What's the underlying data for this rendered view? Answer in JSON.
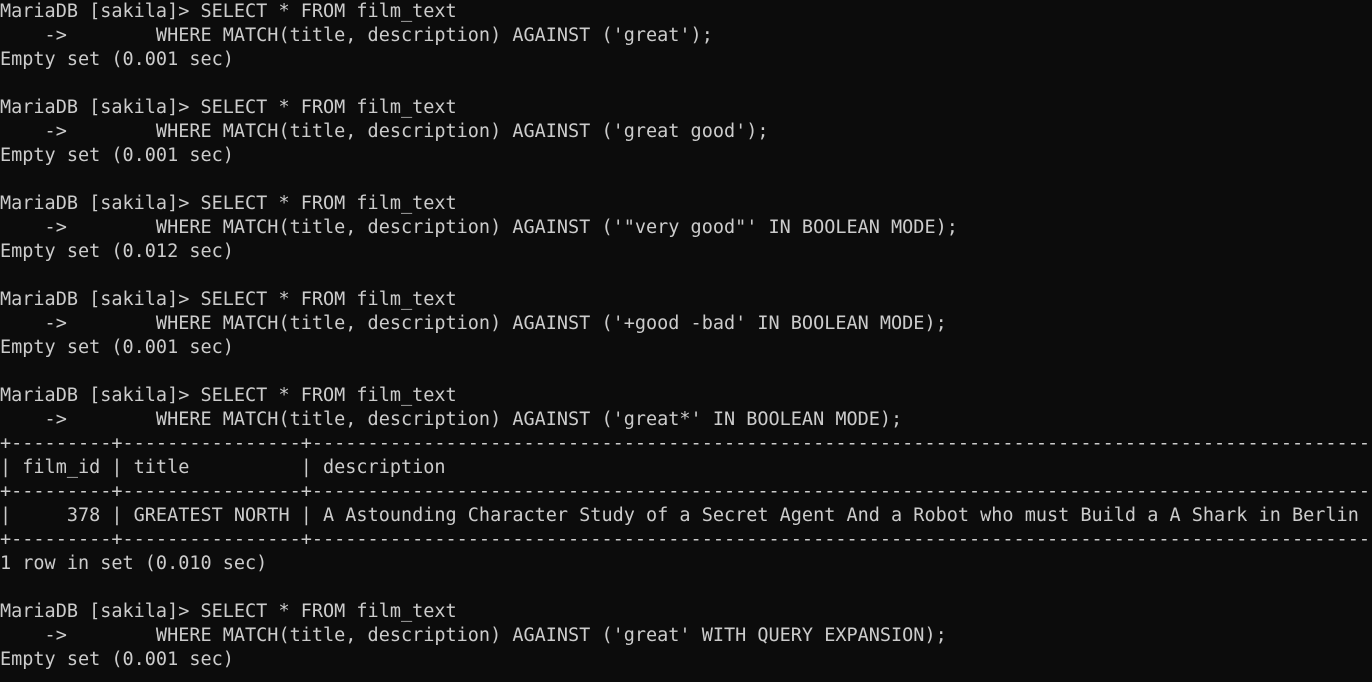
{
  "terminal": {
    "colors": {
      "background": "#0c0c0c",
      "foreground": "#cccccc"
    },
    "lines": [
      "MariaDB [sakila]> SELECT * FROM film_text",
      "    ->        WHERE MATCH(title, description) AGAINST ('great');",
      "Empty set (0.001 sec)",
      "",
      "MariaDB [sakila]> SELECT * FROM film_text",
      "    ->        WHERE MATCH(title, description) AGAINST ('great good');",
      "Empty set (0.001 sec)",
      "",
      "MariaDB [sakila]> SELECT * FROM film_text",
      "    ->        WHERE MATCH(title, description) AGAINST ('\"very good\"' IN BOOLEAN MODE);",
      "Empty set (0.012 sec)",
      "",
      "MariaDB [sakila]> SELECT * FROM film_text",
      "    ->        WHERE MATCH(title, description) AGAINST ('+good -bad' IN BOOLEAN MODE);",
      "Empty set (0.001 sec)",
      "",
      "MariaDB [sakila]> SELECT * FROM film_text",
      "    ->        WHERE MATCH(title, description) AGAINST ('great*' IN BOOLEAN MODE);",
      "+---------+----------------+----------------------------------------------------------------------------------------------------+",
      "| film_id | title          | description                                                                                        |",
      "+---------+----------------+----------------------------------------------------------------------------------------------------+",
      "|     378 | GREATEST NORTH | A Astounding Character Study of a Secret Agent And a Robot who must Build a A Shark in Berlin |",
      "+---------+----------------+----------------------------------------------------------------------------------------------------+",
      "1 row in set (0.010 sec)",
      "",
      "MariaDB [sakila]> SELECT * FROM film_text",
      "    ->        WHERE MATCH(title, description) AGAINST ('great' WITH QUERY EXPANSION);",
      "Empty set (0.001 sec)"
    ]
  }
}
